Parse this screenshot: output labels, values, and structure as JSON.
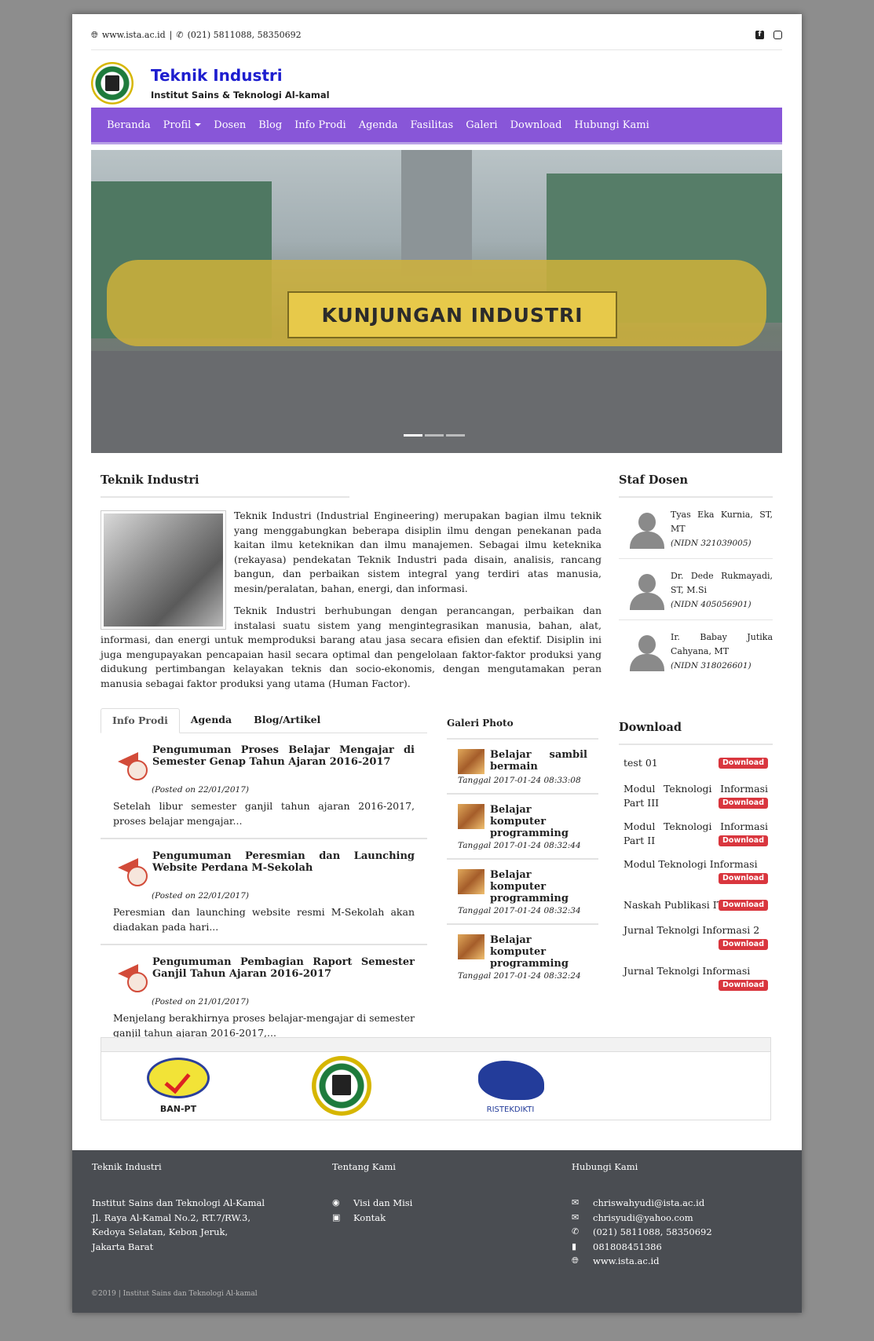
{
  "topbar": {
    "website": "www.ista.ac.id",
    "phone": "(021) 5811088, 58350692",
    "globe_icon": "globe-icon",
    "phone_icon": "phone-icon",
    "social": [
      "facebook-icon",
      "instagram-icon"
    ]
  },
  "brand": {
    "title": "Teknik Industri",
    "subtitle": "Institut Sains & Teknologi Al-kamal",
    "title_color": "#1e1ecf"
  },
  "nav": {
    "bg_color": "#8856d8",
    "items": [
      "Beranda",
      "Profil",
      "Dosen",
      "Blog",
      "Info Prodi",
      "Agenda",
      "Fasilitas",
      "Galeri",
      "Download",
      "Hubungi Kami"
    ]
  },
  "hero": {
    "banner_text": "KUNJUNGAN INDUSTRI",
    "slides": 3,
    "active_slide": 1
  },
  "about": {
    "heading": "Teknik Industri",
    "p1": "Teknik Industri (Industrial Engineering) merupakan bagian ilmu teknik yang menggabungkan beberapa disiplin ilmu dengan penekanan pada kaitan ilmu keteknikan dan ilmu manajemen. Sebagai ilmu keteknika (rekayasa) pendekatan Teknik Industri pada disain, analisis, rancang bangun, dan perbaikan sistem integral yang terdiri atas manusia, mesin/peralatan, bahan, energi, dan informasi.",
    "p2": "Teknik Industri berhubungan dengan perancangan, perbaikan dan instalasi suatu sistem yang mengintegrasikan manusia, bahan, alat, informasi, dan energi untuk memproduksi barang atau jasa secara efisien dan efektif. Disiplin ini juga mengupayakan pencapaian hasil secara optimal dan pengelolaan faktor-faktor produksi yang didukung pertimbangan kelayakan teknis dan socio-ekonomis, dengan mengutamakan peran manusia sebagai faktor produksi yang utama (Human Factor)."
  },
  "staff": {
    "heading": "Staf Dosen",
    "items": [
      {
        "name": "Tyas Eka Kurnia, ST, MT",
        "nidn": "(NIDN 321039005)"
      },
      {
        "name": "Dr. Dede Rukmayadi, ST, M.Si",
        "nidn": "(NIDN 405056901)"
      },
      {
        "name": "Ir. Babay Jutika Cahyana, MT",
        "nidn": "(NIDN 318026601)"
      }
    ]
  },
  "tabs": {
    "labels": [
      "Info Prodi",
      "Agenda",
      "Blog/Artikel"
    ],
    "active": 0,
    "posts": [
      {
        "title": "Pengumuman Proses Belajar Mengajar di Semester Genap Tahun Ajaran 2016-2017",
        "date": "(Posted on 22/01/2017)",
        "excerpt": "Setelah libur semester ganjil tahun ajaran 2016-2017, proses belajar mengajar..."
      },
      {
        "title": "Pengumuman Peresmian dan Launching Website Perdana M-Sekolah",
        "date": "(Posted on 22/01/2017)",
        "excerpt": "Peresmian dan launching website resmi M-Sekolah akan diadakan pada hari..."
      },
      {
        "title": "Pengumuman Pembagian Raport Semester Ganjil Tahun Ajaran 2016-2017",
        "date": "(Posted on 21/01/2017)",
        "excerpt": "Menjelang berakhirnya proses belajar-mengajar di semester ganjil tahun ajaran 2016-2017,..."
      }
    ]
  },
  "gallery": {
    "heading": "Galeri Photo",
    "items": [
      {
        "title": "Belajar sambil bermain",
        "date": "Tanggal 2017-01-24 08:33:08"
      },
      {
        "title": "Belajar komputer programming",
        "date": "Tanggal 2017-01-24 08:32:44"
      },
      {
        "title": "Belajar komputer programming",
        "date": "Tanggal 2017-01-24 08:32:34"
      },
      {
        "title": "Belajar komputer programming",
        "date": "Tanggal 2017-01-24 08:32:24"
      }
    ]
  },
  "downloads": {
    "heading": "Download",
    "badge_label": "Download",
    "badge_color": "#d9363e",
    "items": [
      "test 01",
      "Modul Teknologi Informasi Part III",
      "Modul Teknologi Informasi Part II",
      "Modul Teknologi Informasi",
      "Naskah Publikasi IT",
      "Jurnal Teknolgi Informasi 2",
      "Jurnal Teknolgi Informasi"
    ]
  },
  "partners": {
    "banpt_label": "BAN-PT",
    "ristek_label": "RISTEKDIKTI"
  },
  "footer": {
    "bg_color": "#4a4d52",
    "col1_title": "Teknik Industri",
    "address": [
      "Institut Sains dan Teknologi Al-Kamal",
      "Jl. Raya Al-Kamal No.2, RT.7/RW.3,",
      "Kedoya Selatan, Kebon Jeruk,",
      "Jakarta Barat"
    ],
    "col2_title": "Tentang Kami",
    "links": [
      {
        "icon": "eye-icon",
        "label": "Visi dan Misi"
      },
      {
        "icon": "id-card-icon",
        "label": "Kontak"
      }
    ],
    "col3_title": "Hubungi Kami",
    "contacts": [
      {
        "icon": "envelope-icon",
        "label": "chriswahyudi@ista.ac.id"
      },
      {
        "icon": "envelope-icon",
        "label": "chrisyudi@yahoo.com"
      },
      {
        "icon": "phone-icon",
        "label": "(021) 5811088, 58350692"
      },
      {
        "icon": "mobile-icon",
        "label": "081808451386"
      },
      {
        "icon": "globe-icon",
        "label": "www.ista.ac.id"
      }
    ],
    "copyright": "©2019 | Institut Sains dan Teknologi Al-kamal"
  }
}
